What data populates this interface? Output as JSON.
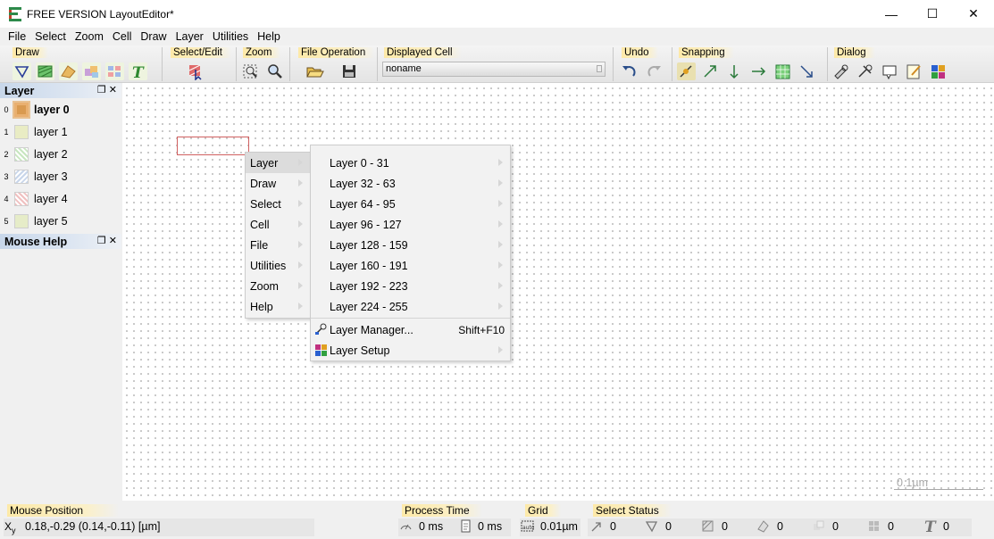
{
  "window": {
    "title": "FREE VERSION LayoutEditor*",
    "minimize": "—",
    "maximize": "☐",
    "close": "✕"
  },
  "menubar": [
    "File",
    "Select",
    "Zoom",
    "Cell",
    "Draw",
    "Layer",
    "Utilities",
    "Help"
  ],
  "toolbar": {
    "draw_label": "Draw",
    "selectedit_label": "Select/Edit",
    "zoom_label": "Zoom",
    "fileop_label": "File Operation",
    "displayedcell_label": "Displayed Cell",
    "displayed_cell_value": "noname",
    "undo_label": "Undo",
    "snapping_label": "Snapping",
    "dialog_label": "Dialog",
    "draw_icons": [
      "polygon-tool-icon",
      "box-tool-icon",
      "path-tool-icon",
      "cell-ref-icon",
      "array-ref-icon",
      "text-tool-icon"
    ]
  },
  "layer_panel": {
    "title": "Layer",
    "layers": [
      {
        "num": "0",
        "name": "layer 0",
        "color": "#d99a50"
      },
      {
        "num": "1",
        "name": "layer 1",
        "color": "#e9ecc4"
      },
      {
        "num": "2",
        "name": "layer 2",
        "color": "#c8e6c0"
      },
      {
        "num": "3",
        "name": "layer 3",
        "color": "#c8d6ea"
      },
      {
        "num": "4",
        "name": "layer 4",
        "color": "#f0c0c0"
      },
      {
        "num": "5",
        "name": "layer 5",
        "color": "#e6ecc8"
      }
    ]
  },
  "mouse_help_panel": {
    "title": "Mouse Help"
  },
  "context_menu": {
    "items": [
      "Layer",
      "Draw",
      "Select",
      "Cell",
      "File",
      "Utilities",
      "Zoom",
      "Help"
    ]
  },
  "layer_submenu": {
    "ranges": [
      "Layer 0 - 31",
      "Layer 32 - 63",
      "Layer 64 - 95",
      "Layer 96 - 127",
      "Layer 128 - 159",
      "Layer 160 - 191",
      "Layer 192 - 223",
      "Layer 224 - 255"
    ],
    "layer_manager": "Layer Manager...",
    "layer_manager_shortcut": "Shift+F10",
    "layer_setup": "Layer Setup"
  },
  "canvas": {
    "scale_label": "0.1µm"
  },
  "statusbar": {
    "mouse_position_label": "Mouse Position",
    "mouse_position_value": "0.18,-0.29 (0.14,-0.11) [µm]",
    "process_time_label": "Process Time",
    "process_time_1": "0 ms",
    "process_time_2": "0 ms",
    "grid_label": "Grid",
    "grid_value": "0.01µm",
    "select_status_label": "Select Status",
    "select_counts": [
      "0",
      "0",
      "0",
      "0",
      "0",
      "0",
      "0"
    ]
  }
}
